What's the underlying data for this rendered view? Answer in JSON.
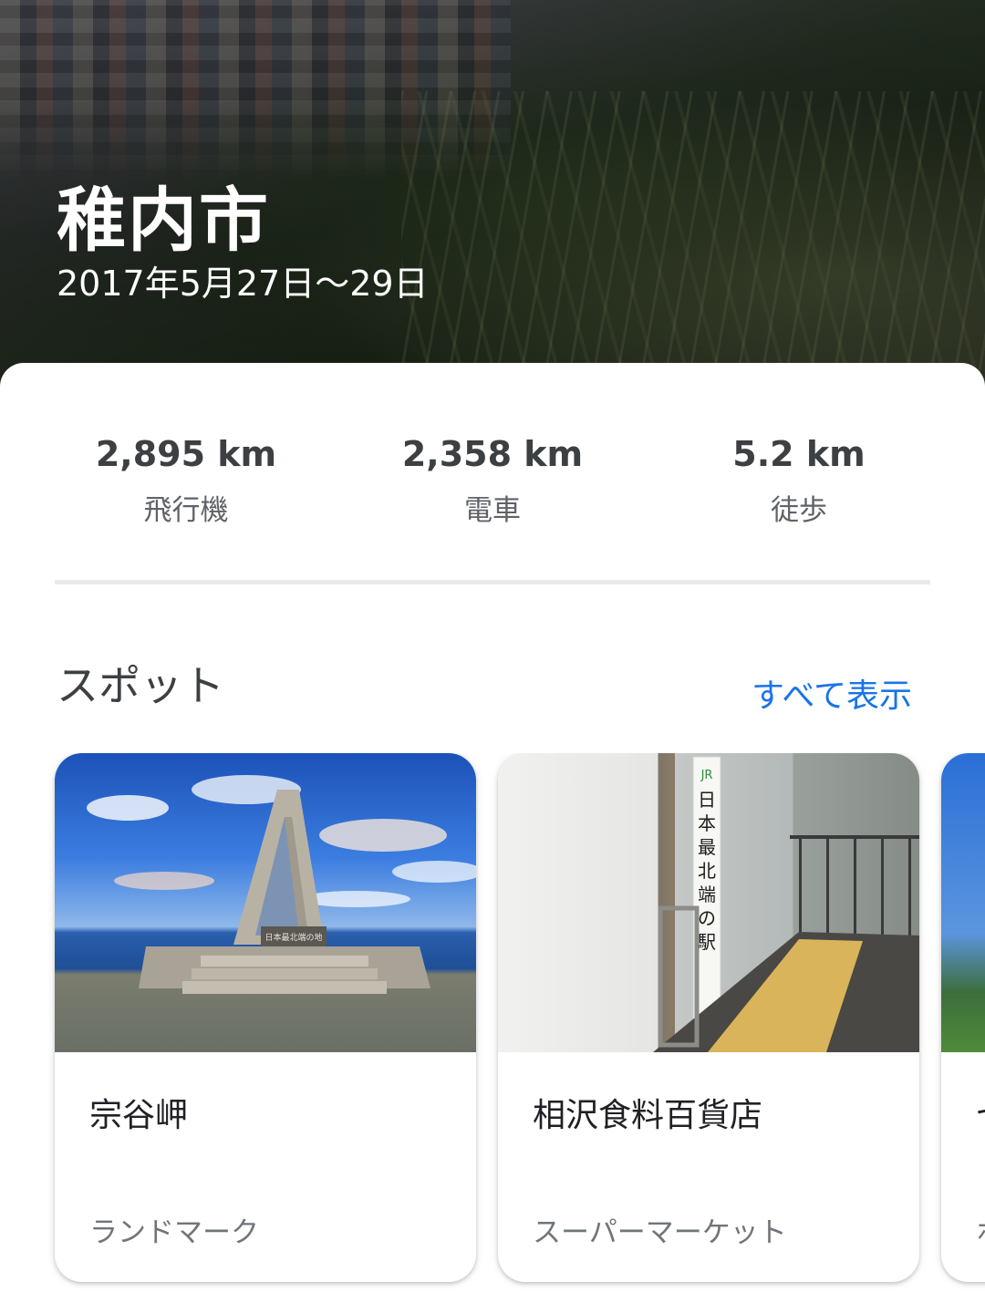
{
  "hero": {
    "title": "稚内市",
    "dates": "2017年5月27日〜29日"
  },
  "stats": [
    {
      "value": "2,895 km",
      "label": "飛行機"
    },
    {
      "value": "2,358 km",
      "label": "電車"
    },
    {
      "value": "5.2 km",
      "label": "徒歩"
    }
  ],
  "spots": {
    "title": "スポット",
    "show_all": "すべて表示",
    "items": [
      {
        "name": "宗谷岬",
        "category": "ランドマーク",
        "image_text": "日本最北端の地"
      },
      {
        "name": "相沢食料百貨店",
        "category": "スーパーマーケット",
        "image_text": "日本最北端の駅"
      },
      {
        "name": "セ",
        "category": "ホ"
      }
    ]
  },
  "colors": {
    "accent": "#1a73e8",
    "primary_text": "#3c4043",
    "secondary_text": "#5f6368",
    "divider": "#e8eaed"
  }
}
